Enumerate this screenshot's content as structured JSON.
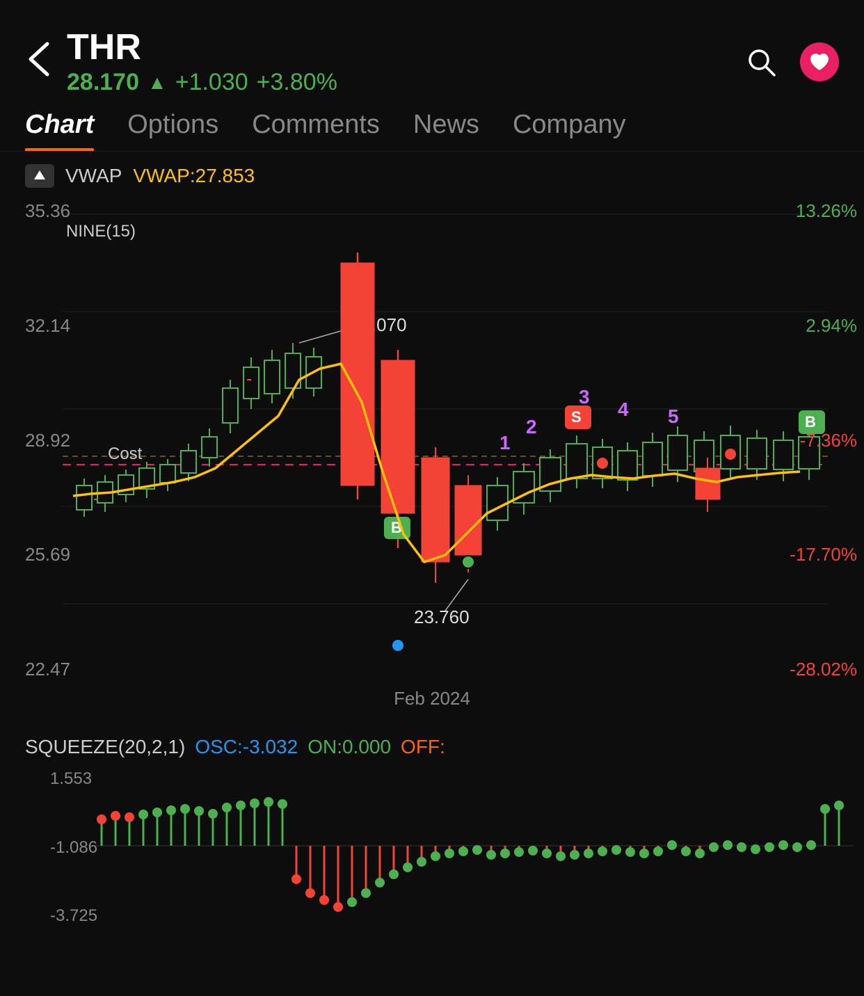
{
  "header": {
    "back_label": "‹",
    "ticker": "THR",
    "price": "28.170",
    "arrow": "▲",
    "change": "+1.030",
    "pct_change": "+3.80%"
  },
  "tabs": [
    {
      "label": "Chart",
      "active": true
    },
    {
      "label": "Options",
      "active": false
    },
    {
      "label": "Comments",
      "active": false
    },
    {
      "label": "News",
      "active": false
    },
    {
      "label": "Company",
      "active": false
    }
  ],
  "vwap": {
    "label": "VWAP",
    "value": "VWAP:27.853"
  },
  "chart": {
    "nine_label": "NINE(15)",
    "price_high": "35.36",
    "price_mid1": "32.14",
    "price_mid2": "28.92",
    "price_mid3": "25.69",
    "price_low": "22.47",
    "pct_high": "13.26%",
    "pct_mid1": "2.94%",
    "pct_mid2": "-7.36%",
    "pct_mid3": "-17.70%",
    "pct_low": "-28.02%",
    "annotation_high": "34.070",
    "annotation_low": "23.760",
    "cost_label": "Cost",
    "date_label": "Feb 2024"
  },
  "squeeze": {
    "title": "SQUEEZE(20,2,1)",
    "osc_label": "OSC:",
    "osc_value": "-3.032",
    "on_label": "ON:",
    "on_value": "0.000",
    "off_label": "OFF:",
    "off_value": "",
    "level_high": "1.553",
    "level_mid": "-1.086",
    "level_low": "-3.725"
  }
}
